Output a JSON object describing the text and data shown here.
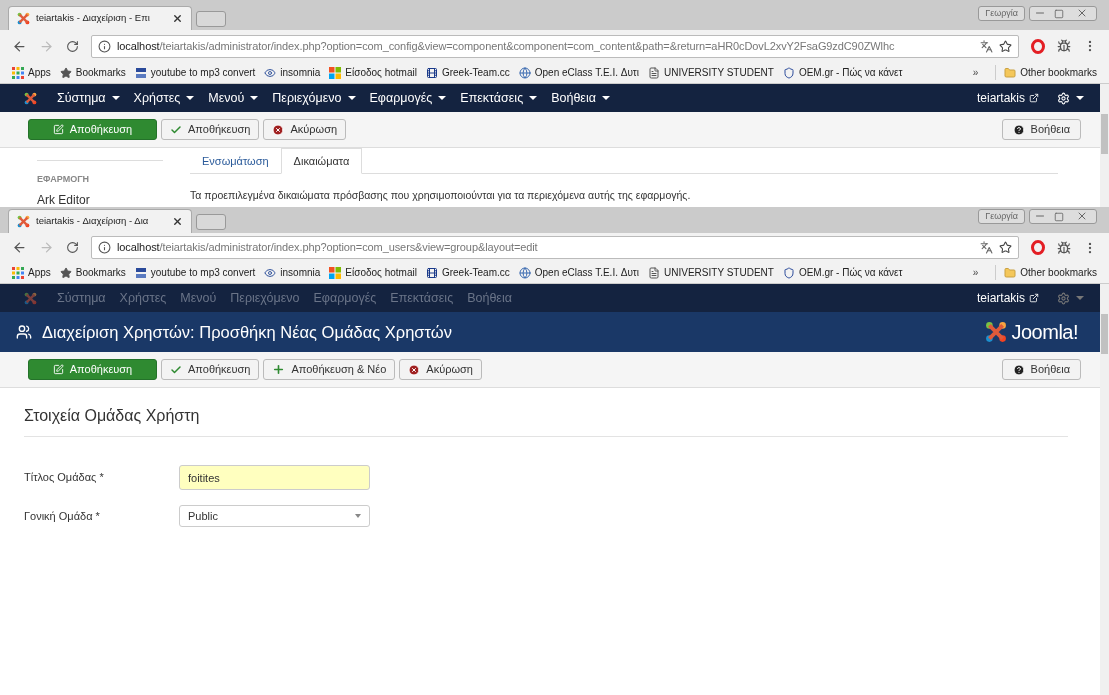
{
  "windows": [
    {
      "tab": {
        "title": "teiartakis - Διαχείριση - Επι",
        "selected": true
      },
      "profile": "Γεωργία",
      "url": {
        "host": "localhost",
        "path": "/teiartakis/administrator/index.php?option=com_config&view=component&component=com_content&path=&return=aHR0cDovL2xvY2FsaG9zdC90ZWlhc"
      },
      "bookmarks": [
        {
          "kind": "apps",
          "label": "Apps"
        },
        {
          "kind": "star",
          "label": "Bookmarks"
        },
        {
          "kind": "yt",
          "label": "youtube to mp3 convert"
        },
        {
          "kind": "eyes",
          "label": "insomnia"
        },
        {
          "kind": "windows",
          "label": "Είσοδος hotmail"
        },
        {
          "kind": "film",
          "label": "Greek-Team.cc"
        },
        {
          "kind": "globe",
          "label": "Open eClass T.E.I. Δυτι"
        },
        {
          "kind": "page",
          "label": "UNIVERSITY STUDENT"
        },
        {
          "kind": "shield",
          "label": "OEM.gr - Πώς να κάνετ"
        }
      ],
      "more_bookmarks": "»",
      "other_bookmarks": "Other bookmarks",
      "menu": {
        "disabled": false,
        "items": [
          "Σύστημα",
          "Χρήστες",
          "Μενού",
          "Περιεχόμενο",
          "Εφαρμογές",
          "Επεκτάσεις",
          "Βοήθεια"
        ]
      },
      "user": "teiartakis",
      "toolbar": [
        {
          "kind": "save-primary",
          "label": "Αποθήκευση"
        },
        {
          "kind": "check",
          "label": "Αποθήκευση"
        },
        {
          "kind": "cancel",
          "label": "Ακύρωση"
        }
      ],
      "help": "Βοήθεια",
      "content": {
        "kind": "options",
        "sidebar_heading": "ΕΦΑΡΜΟΓΗ",
        "sidebar_items": [
          "Ark Editor"
        ],
        "tabs": [
          {
            "label": "Ενσωμάτωση",
            "selected": false
          },
          {
            "label": "Δικαιώματα",
            "selected": true
          }
        ],
        "description": "Τα προεπιλεγμένα δικαιώματα πρόσβασης που χρησιμοποιούνται για τα περιεχόμενα αυτής της εφαρμογής."
      }
    },
    {
      "tab": {
        "title": "teiartakis - Διαχείριση - Δια",
        "selected": true
      },
      "profile": "Γεωργία",
      "url": {
        "host": "localhost",
        "path": "/teiartakis/administrator/index.php?option=com_users&view=group&layout=edit"
      },
      "bookmarks": [
        {
          "kind": "apps",
          "label": "Apps"
        },
        {
          "kind": "star",
          "label": "Bookmarks"
        },
        {
          "kind": "yt",
          "label": "youtube to mp3 convert"
        },
        {
          "kind": "eyes",
          "label": "insomnia"
        },
        {
          "kind": "windows",
          "label": "Είσοδος hotmail"
        },
        {
          "kind": "film",
          "label": "Greek-Team.cc"
        },
        {
          "kind": "globe",
          "label": "Open eClass T.E.I. Δυτι"
        },
        {
          "kind": "page",
          "label": "UNIVERSITY STUDENT"
        },
        {
          "kind": "shield",
          "label": "OEM.gr - Πώς να κάνετ"
        }
      ],
      "more_bookmarks": "»",
      "other_bookmarks": "Other bookmarks",
      "menu": {
        "disabled": true,
        "items": [
          "Σύστημα",
          "Χρήστες",
          "Μενού",
          "Περιεχόμενο",
          "Εφαρμογές",
          "Επεκτάσεις",
          "Βοήθεια"
        ]
      },
      "user": "teiartakis",
      "header": {
        "title": "Διαχείριση Χρηστών: Προσθήκη Νέας Ομάδας Χρηστών",
        "logo": "Joomla!"
      },
      "toolbar": [
        {
          "kind": "save-primary",
          "label": "Αποθήκευση"
        },
        {
          "kind": "check",
          "label": "Αποθήκευση"
        },
        {
          "kind": "plus",
          "label": "Αποθήκευση & Νέο"
        },
        {
          "kind": "cancel",
          "label": "Ακύρωση"
        }
      ],
      "help": "Βοήθεια",
      "content": {
        "kind": "form",
        "title": "Στοιχεία Ομάδας Χρήστη",
        "fields": [
          {
            "kind": "text",
            "label": "Τίτλος Ομάδας *",
            "value": "foitites",
            "highlighted": true
          },
          {
            "kind": "select",
            "label": "Γονική Ομάδα *",
            "value": "Public",
            "highlighted": false
          }
        ]
      }
    }
  ]
}
